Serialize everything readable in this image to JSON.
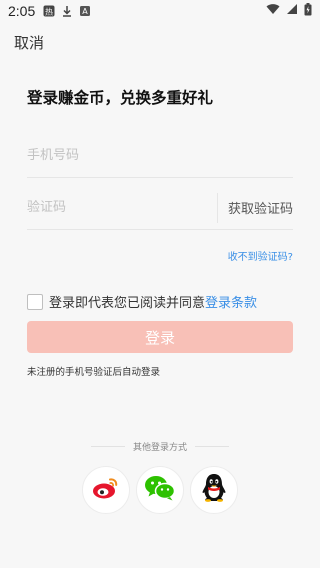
{
  "status": {
    "time": "2:05",
    "icons": [
      "hot-news-icon",
      "download-icon",
      "a-icon",
      "wifi-icon",
      "signal-icon",
      "battery-icon"
    ]
  },
  "header": {
    "cancel_label": "取消"
  },
  "headline": "登录赚金币，兑换多重好礼",
  "phone_field": {
    "placeholder": "手机号码",
    "value": ""
  },
  "code_field": {
    "placeholder": "验证码",
    "value": "",
    "get_code_label": "获取验证码"
  },
  "no_code_link": "收不到验证码?",
  "agreement": {
    "prefix": "登录即代表您已阅读并同意",
    "link": "登录条款",
    "checked": false
  },
  "login_button": "登录",
  "hint": "未注册的手机号验证后自动登录",
  "other_login": {
    "title": "其他登录方式",
    "providers": [
      "weibo-icon",
      "wechat-icon",
      "qq-icon"
    ]
  },
  "colors": {
    "accent": "#3a8fe6",
    "login_button": "#f8c0b7",
    "background": "#f7f7f7"
  }
}
